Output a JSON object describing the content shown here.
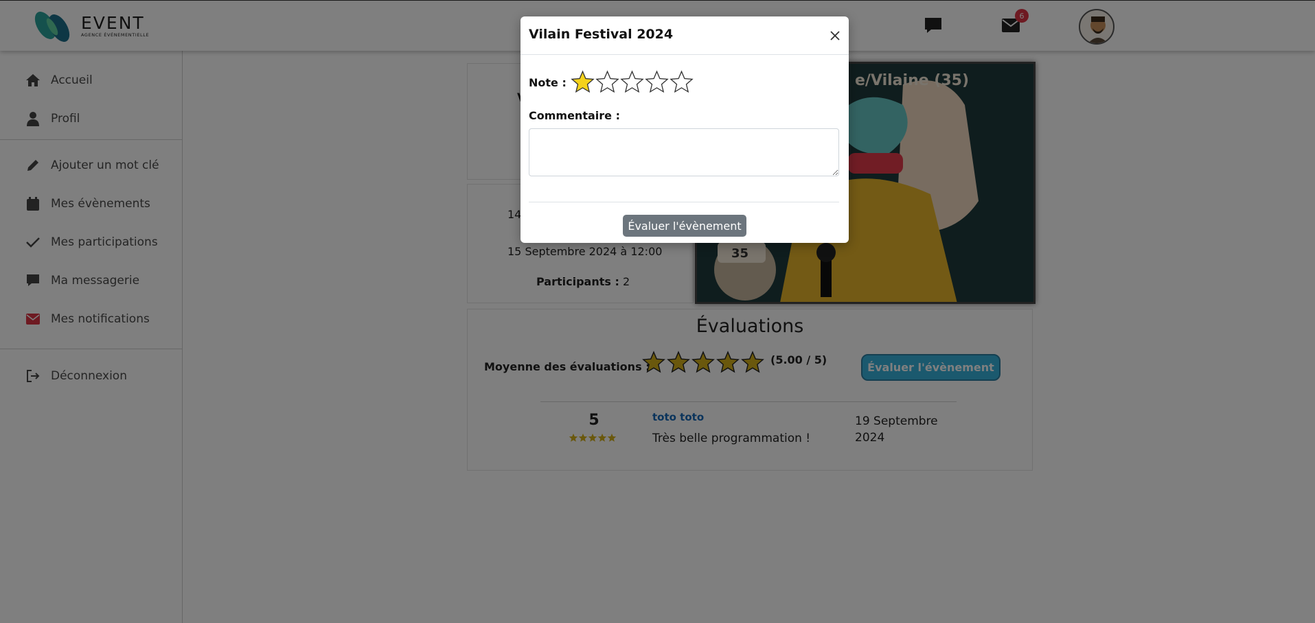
{
  "header": {
    "brand": "EVENT",
    "brand_sub": "AGENCE ÉVÉNEMENTIELLE",
    "messages_icon": "chat-icon",
    "mail_icon": "envelope-icon",
    "mail_badge": "6",
    "avatar": "user-avatar"
  },
  "sidebar": {
    "items": [
      {
        "label": "Accueil",
        "icon": "home-icon"
      },
      {
        "label": "Profil",
        "icon": "user-icon"
      },
      {
        "label": "Ajouter un mot clé",
        "icon": "pencil-icon"
      },
      {
        "label": "Mes évènements",
        "icon": "calendar-icon"
      },
      {
        "label": "Mes participations",
        "icon": "check-icon"
      },
      {
        "label": "Ma messagerie",
        "icon": "chat-icon"
      },
      {
        "label": "Mes notifications",
        "icon": "envelope-icon"
      },
      {
        "label": "Déconnexion",
        "icon": "logout-icon"
      }
    ],
    "notification_color": "#dc3545"
  },
  "event": {
    "title_partial": "V",
    "date_start_partial": "14",
    "date_end": "15 Septembre 2024 à 12:00",
    "participants_label": "Participants :",
    "participants_value": "2",
    "image_text": "e/Vilaine (35)"
  },
  "evaluations": {
    "title": "Évaluations",
    "average_label": "Moyenne des évaluations :",
    "average_stars": 5,
    "average_score": "(5.00 / 5)",
    "button_label": "Évaluer l'évènement",
    "reviews": [
      {
        "score": "5",
        "stars": 5,
        "author": "toto toto",
        "comment": "Très belle programmation !",
        "date": "19 Septembre 2024"
      }
    ]
  },
  "modal": {
    "title": "Vilain Festival 2024",
    "note_label": "Note :",
    "rating": 1,
    "rating_max": 5,
    "comment_label": "Commentaire :",
    "comment_value": "",
    "submit_label": "Évaluer l'évènement",
    "close_icon": "close-icon"
  },
  "colors": {
    "star_filled": "#f5d21b",
    "star_avg": "#d4b01a",
    "accent_button": "#36b3dd",
    "submit_button": "#6c757d",
    "author_link": "#1669b8"
  }
}
